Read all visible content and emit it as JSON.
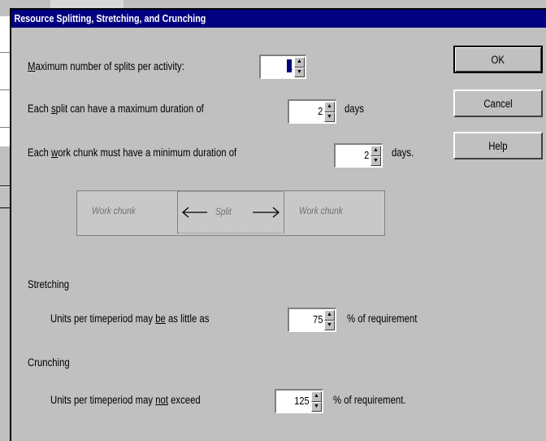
{
  "dialog": {
    "title": "Resource Splitting, Stretching, and Crunching"
  },
  "splitting": {
    "max_splits": {
      "label": "Maximum number of splits per activity:",
      "value": "1"
    },
    "max_duration": {
      "label": "Each split can have a maximum duration of",
      "value": "2",
      "unit": "days"
    },
    "min_chunk": {
      "label": "Each work chunk must have a minimum duration of",
      "value": "2",
      "unit": "days."
    }
  },
  "diagram": {
    "left_label": "Work chunk",
    "split_label": "Split",
    "right_label": "Work chunk"
  },
  "stretching": {
    "heading": "Stretching",
    "label": "Units per timeperiod may be as little as",
    "value": "75",
    "unit": "% of requirement"
  },
  "crunching": {
    "heading": "Crunching",
    "label": "Units per timeperiod may not exceed",
    "value": "125",
    "unit": "% of requirement."
  },
  "buttons": {
    "ok": "OK",
    "cancel": "Cancel",
    "help": "Help"
  },
  "colors": {
    "titlebar": "#000080",
    "face": "#c0c0c0"
  }
}
